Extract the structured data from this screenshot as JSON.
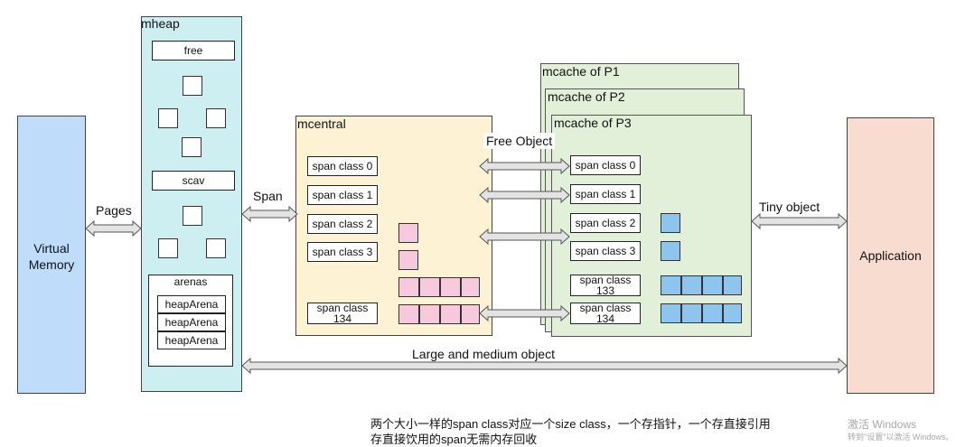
{
  "virtual_memory": {
    "line1": "Virtual",
    "line2": "Memory"
  },
  "application": {
    "label": "Application"
  },
  "mheap": {
    "title": "mheap",
    "free_label": "free",
    "scav_label": "scav",
    "arenas_title": "arenas",
    "heap_arenas": [
      "heapArena",
      "heapArena",
      "heapArena"
    ]
  },
  "mcentral": {
    "title": "mcentral",
    "span_classes": [
      "span class 0",
      "span class 1",
      "span class 2",
      "span class 3"
    ],
    "span_class_134": {
      "line1": "span class",
      "line2": "134"
    }
  },
  "mcache": {
    "titles": [
      "mcache of P1",
      "mcache of P2",
      "mcache of P3"
    ],
    "span_classes": [
      "span class 0",
      "span class 1",
      "span class 2",
      "span class 3"
    ],
    "span_class_133": {
      "line1": "span class",
      "line2": "133"
    },
    "span_class_134": {
      "line1": "span class",
      "line2": "134"
    }
  },
  "arrows": {
    "pages": "Pages",
    "span": "Span",
    "free_object": "Free Object",
    "tiny_object": "Tiny object",
    "large_medium": "Large and medium object"
  },
  "notes": {
    "line1": "两个大小一样的span class对应一个size class，一个存指针，一个存直接引用",
    "line2": "存直接饮用的span无需内存回收"
  },
  "watermark": {
    "line1": "激活 Windows",
    "line2": "转到\"设置\"以激活 Windows。"
  },
  "colors": {
    "virtual_memory_fill": "#bfdcfb",
    "mheap_fill": "#cdeff2",
    "mcentral_fill": "#fdf3d4",
    "mcache_fill": "#e2efd9",
    "application_fill": "#f9dcd0",
    "pink_block": "#f7c9dc",
    "blue_block": "#8ec5ef"
  }
}
